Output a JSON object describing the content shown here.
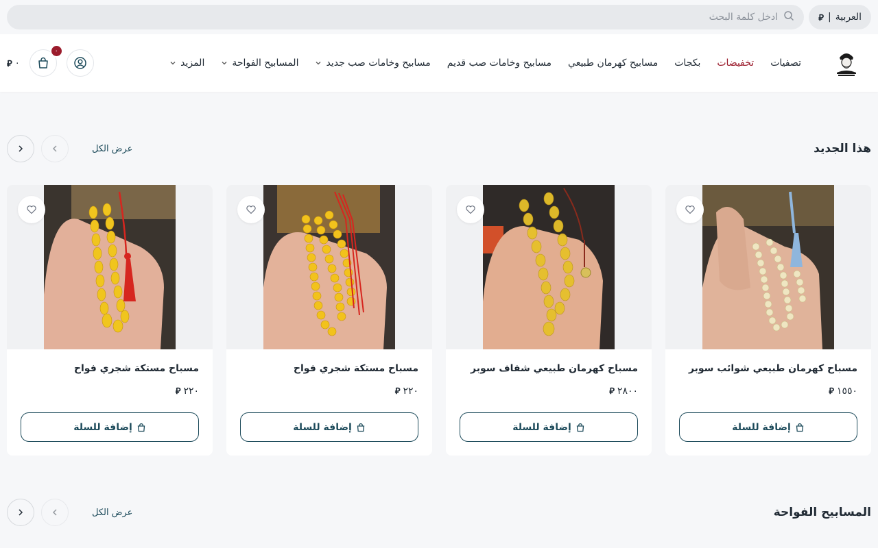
{
  "topbar": {
    "language": "العربية",
    "currency_symbol": "⃁",
    "search_placeholder": "ادخل كلمة البحث"
  },
  "header": {
    "nav": [
      {
        "label": "تصفيات",
        "dropdown": false,
        "highlight": false
      },
      {
        "label": "تخفيضات",
        "dropdown": false,
        "highlight": true
      },
      {
        "label": "بكجات",
        "dropdown": false,
        "highlight": false
      },
      {
        "label": "مسابيح كهرمان طبيعي",
        "dropdown": false,
        "highlight": false
      },
      {
        "label": "مسابيح وخامات صب قديم",
        "dropdown": false,
        "highlight": false
      },
      {
        "label": "مسابيح وخامات صب جديد",
        "dropdown": true,
        "highlight": false
      },
      {
        "label": "المسابيح الفواحة",
        "dropdown": true,
        "highlight": false
      },
      {
        "label": "المزيد",
        "dropdown": true,
        "highlight": false
      }
    ],
    "cart_count": "٠",
    "cart_total": "٠",
    "accent_color": "#9b1c2c",
    "primary_color": "#1c4a5a"
  },
  "sections": [
    {
      "title": "هذا الجديد",
      "view_all": "عرض الكل"
    },
    {
      "title": "المسابيح الفواحة",
      "view_all": "عرض الكل"
    }
  ],
  "products": [
    {
      "name": "مسباح كهرمان طبيعي شوائب سوبر",
      "price": "١٥٥٠",
      "add_label": "إضافة للسلة",
      "bead_color": "#efe6c2",
      "tassel_color": "#8fb6dd"
    },
    {
      "name": "مسباح كهرمان طبيعي شفاف سوبر",
      "price": "٢٨٠٠",
      "add_label": "إضافة للسلة",
      "bead_color": "#e6c02a",
      "tassel_color": "#8a2a1c"
    },
    {
      "name": "مسباح مستكة شجري فواح",
      "price": "٢٢٠",
      "add_label": "إضافة للسلة",
      "bead_color": "#f2c21c",
      "tassel_color": "#d6261f"
    },
    {
      "name": "مسباح مستكة شجري فواح",
      "price": "٢٢٠",
      "add_label": "إضافة للسلة",
      "bead_color": "#f0c51e",
      "tassel_color": "#d6261f"
    }
  ]
}
